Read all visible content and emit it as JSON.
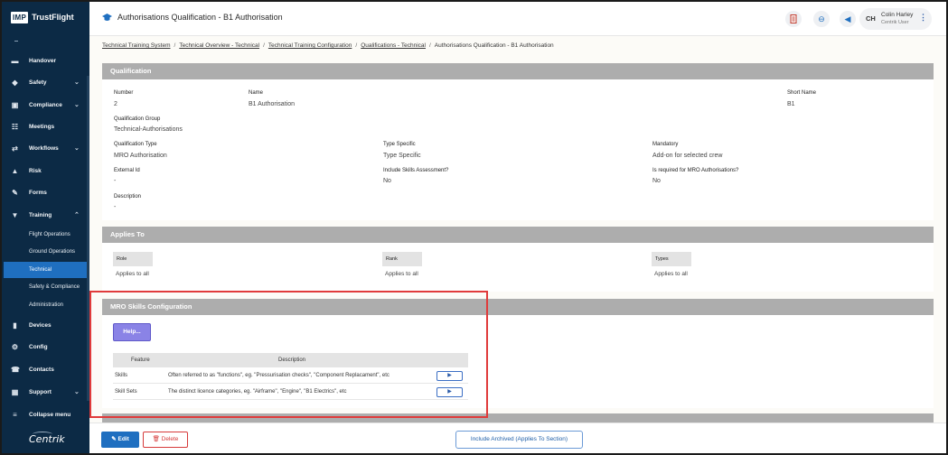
{
  "brand": {
    "badge": "IMP",
    "name": "TrustFlight",
    "footer_logo": "Centrik"
  },
  "sidebar": {
    "items": [
      {
        "label": "Handover",
        "icon": "handover-icon",
        "glyph": "▬"
      },
      {
        "label": "Safety",
        "icon": "shield-icon",
        "glyph": "◆",
        "chevron": "⌄"
      },
      {
        "label": "Compliance",
        "icon": "compliance-icon",
        "glyph": "▣",
        "chevron": "⌄"
      },
      {
        "label": "Meetings",
        "icon": "meetings-icon",
        "glyph": "☷"
      },
      {
        "label": "Workflows",
        "icon": "workflow-icon",
        "glyph": "⇄",
        "chevron": "⌄"
      },
      {
        "label": "Risk",
        "icon": "risk-icon",
        "glyph": "▲"
      },
      {
        "label": "Forms",
        "icon": "forms-icon",
        "glyph": "✎"
      },
      {
        "label": "Training",
        "icon": "graduation-cap-icon",
        "glyph": "▼",
        "chevron": "⌃"
      }
    ],
    "training_sub": [
      "Flight Operations",
      "Ground Operations",
      "Technical",
      "Safety & Compliance",
      "Administration"
    ],
    "lower_items": [
      {
        "label": "Devices",
        "icon": "devices-icon",
        "glyph": "▮"
      },
      {
        "label": "Config",
        "icon": "config-icon",
        "glyph": "⚙"
      },
      {
        "label": "Contacts",
        "icon": "contacts-icon",
        "glyph": "☎"
      },
      {
        "label": "Support",
        "icon": "support-icon",
        "glyph": "▦",
        "chevron": "⌄"
      },
      {
        "label": "Collapse menu",
        "icon": "collapse-icon",
        "glyph": "≡"
      }
    ]
  },
  "header": {
    "title": "Authorisations Qualification  - B1 Authorisation",
    "user_initials": "CH",
    "user_name": "Colin Harley",
    "user_role": "Centrik User",
    "menu_glyph": "⋮",
    "link_glyph": "⊖",
    "megaphone_glyph": "◀"
  },
  "breadcrumb": {
    "links": [
      "Technical Training System",
      "Technical Overview - Technical",
      "Technical Training Configuration",
      "Qualifications - Technical"
    ],
    "current": "Authorisations Qualification - B1 Authorisation",
    "separator": "/"
  },
  "qualification": {
    "heading": "Qualification",
    "number_label": "Number",
    "number": "2",
    "name_label": "Name",
    "name": "B1 Authorisation",
    "short_name_label": "Short Name",
    "short_name": "B1",
    "group_label": "Qualification Group",
    "group": "Technical-Authorisations",
    "type_label": "Qualification Type",
    "type": "MRO Authorisation",
    "type_specific_label": "Type Specific",
    "type_specific": "Type Specific",
    "mandatory_label": "Mandatory",
    "mandatory": "Add-on for selected crew",
    "external_id_label": "External Id",
    "external_id": "-",
    "skills_assessment_label": "Include Skills Assessment?",
    "skills_assessment": "No",
    "mro_required_label": "Is required for MRO Authorisations?",
    "mro_required": "No",
    "description_label": "Description",
    "description": "-"
  },
  "applies_to": {
    "heading": "Applies To",
    "columns": [
      {
        "header": "Role",
        "value": "Applies to all"
      },
      {
        "header": "Rank",
        "value": "Applies to all"
      },
      {
        "header": "Types",
        "value": "Applies to all"
      }
    ]
  },
  "mro": {
    "heading": "MRO Skills Configuration",
    "help_label": "Help...",
    "col_feature": "Feature",
    "col_description": "Description",
    "rows": [
      {
        "feature": "Skills",
        "description": "Often referred to as \"functions\", eg. \"Pressurisation checks\", \"Component Replacament\", etc",
        "action": "▶"
      },
      {
        "feature": "Skill Sets",
        "description": "The distinct licence categories, eg. \"Airframe\", \"Engine\", \"B1 Electrics\", etc",
        "action": "▶"
      }
    ]
  },
  "footer": {
    "edit_label": "Edit",
    "delete_label": "Delete",
    "archived_label": "Include Archived (Applies To Section)"
  },
  "colors": {
    "sidebar": "#0c2a45",
    "accent": "#1f6fc0",
    "section_bar": "#adadad",
    "highlight": "#e03b3b",
    "help": "#8a83e6"
  }
}
